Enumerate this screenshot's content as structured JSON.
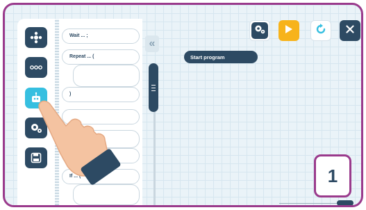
{
  "palette": {
    "blocks": [
      {
        "label": "Wait ... ;"
      },
      {
        "label": "Repeat ... ("
      },
      {
        "label": ")"
      },
      {
        "label": ""
      },
      {
        "label": ")"
      },
      {
        "label": "If ... ("
      }
    ]
  },
  "canvas": {
    "start_block_label": "Start program"
  },
  "callout": {
    "number": "1"
  },
  "zoom": {
    "minus_label": "−",
    "plus_label": "+"
  },
  "icons": {
    "rail": [
      "movement-icon",
      "more-dots-icon",
      "robot-sensor-icon",
      "settings-gears-icon",
      "save-floppy-icon"
    ],
    "toolbar": [
      "settings-icon",
      "play-icon",
      "reset-icon",
      "close-icon"
    ]
  },
  "colors": {
    "navy": "#2d4a63",
    "cyan": "#36bfe0",
    "orange": "#f7b31b",
    "callout_border": "#9a3a8c",
    "background": "#eaf3f8"
  },
  "collapse_glyph": "«"
}
